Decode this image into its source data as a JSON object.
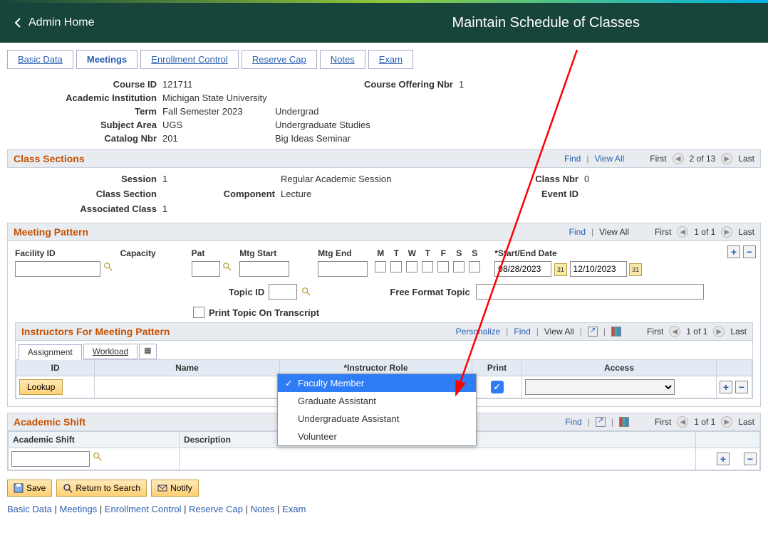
{
  "header": {
    "back_label": "Admin Home",
    "page_title": "Maintain Schedule of Classes"
  },
  "tabs": [
    {
      "label": "Basic Data",
      "ak": "B"
    },
    {
      "label": "Meetings",
      "active": true
    },
    {
      "label": "Enrollment Control",
      "ak": "E"
    },
    {
      "label": "Reserve Cap",
      "ak": "R"
    },
    {
      "label": "Notes",
      "ak": "N"
    },
    {
      "label": "Exam",
      "ak": "E"
    }
  ],
  "course": {
    "labels": {
      "course_id": "Course ID",
      "course_offering_nbr": "Course Offering Nbr",
      "academic_institution": "Academic Institution",
      "term": "Term",
      "term_level": "Undergrad",
      "subject_area": "Subject Area",
      "subject_desc": "Undergraduate Studies",
      "catalog_nbr": "Catalog Nbr",
      "catalog_desc": "Big Ideas Seminar"
    },
    "course_id": "121711",
    "course_offering_nbr": "1",
    "academic_institution": "Michigan State University",
    "term": "Fall Semester 2023",
    "subject_area": "UGS",
    "catalog_nbr": "201"
  },
  "class_sections": {
    "title": "Class Sections",
    "find": "Find",
    "view_all": "View All",
    "first": "First",
    "counter": "2 of 13",
    "last": "Last",
    "session_label": "Session",
    "session": "1",
    "session_desc": "Regular Academic Session",
    "class_nbr_label": "Class Nbr",
    "class_nbr": "0",
    "class_section_label": "Class Section",
    "component_label": "Component",
    "component": "Lecture",
    "event_id_label": "Event ID",
    "assoc_class_label": "Associated Class",
    "assoc_class": "1"
  },
  "meeting_pattern": {
    "title": "Meeting Pattern",
    "find": "Find",
    "view_all": "View All",
    "first": "First",
    "counter": "1 of 1",
    "last": "Last",
    "facility_id": "Facility ID",
    "capacity": "Capacity",
    "pat": "Pat",
    "mtg_start": "Mtg Start",
    "mtg_end": "Mtg End",
    "days": [
      "M",
      "T",
      "W",
      "T",
      "F",
      "S",
      "S"
    ],
    "start_end_label": "*Start/End Date",
    "start_date": "08/28/2023",
    "end_date": "12/10/2023",
    "topic_id_label": "Topic ID",
    "free_format_label": "Free Format Topic",
    "print_topic_label": "Print Topic On Transcript"
  },
  "instructors": {
    "title": "Instructors For Meeting Pattern",
    "personalize": "Personalize",
    "find": "Find",
    "view_all": "View All",
    "first": "First",
    "counter": "1 of 1",
    "last": "Last",
    "subtabs": {
      "assignment": "Assignment",
      "workload": "Workload"
    },
    "cols": {
      "id": "ID",
      "name": "Name",
      "role": "*Instructor Role",
      "print": "Print",
      "access": "Access"
    },
    "lookup": "Lookup",
    "role_options": [
      "Faculty Member",
      "Graduate Assistant",
      "Undergraduate Assistant",
      "Volunteer"
    ],
    "role_selected": "Faculty Member"
  },
  "academic_shift": {
    "title": "Academic Shift",
    "find": "Find",
    "first": "First",
    "counter": "1 of 1",
    "last": "Last",
    "col_shift": "Academic Shift",
    "col_desc": "Description"
  },
  "footer": {
    "save": "Save",
    "return": "Return to Search",
    "notify": "Notify"
  },
  "bottom_links": [
    "Basic Data",
    "Meetings",
    "Enrollment Control",
    "Reserve Cap",
    "Notes",
    "Exam"
  ]
}
